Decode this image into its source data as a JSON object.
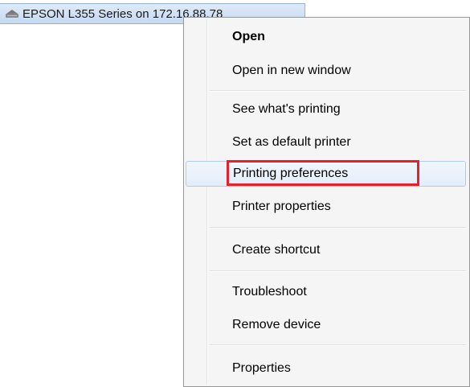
{
  "printer": {
    "name": "EPSON L355 Series on 172.16.88.78"
  },
  "menu": {
    "items": [
      {
        "label": "Open"
      },
      {
        "label": "Open in new window"
      },
      {
        "label": "See what's printing"
      },
      {
        "label": "Set as default printer"
      },
      {
        "label": "Printing preferences"
      },
      {
        "label": "Printer properties"
      },
      {
        "label": "Create shortcut"
      },
      {
        "label": "Troubleshoot"
      },
      {
        "label": "Remove device"
      },
      {
        "label": "Properties"
      }
    ],
    "highlighted_item": "Printing preferences",
    "hovered_item": "Printing preferences"
  },
  "colors": {
    "highlight_border": "#e8202a",
    "selection_fill": "#c6d9f1",
    "menu_background": "#f5f5f5"
  }
}
